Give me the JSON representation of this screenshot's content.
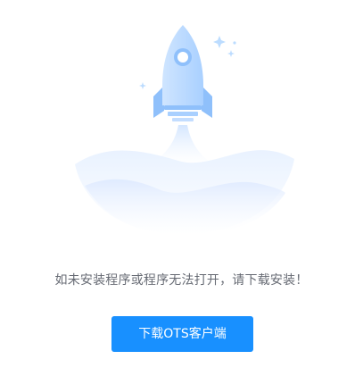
{
  "illustration": {
    "icon": "rocket-launch-illustration",
    "colors": {
      "rocket_body": "#bcdcff",
      "rocket_fin": "#8fc0fb",
      "cloud": "#eef5ff",
      "sparkle": "#bcdcff"
    }
  },
  "message": {
    "text": "如未安装程序或程序无法打开，请下载安装！",
    "color": "#666a73"
  },
  "download_button": {
    "label": "下载OTS客户端",
    "color": "#1890ff"
  }
}
